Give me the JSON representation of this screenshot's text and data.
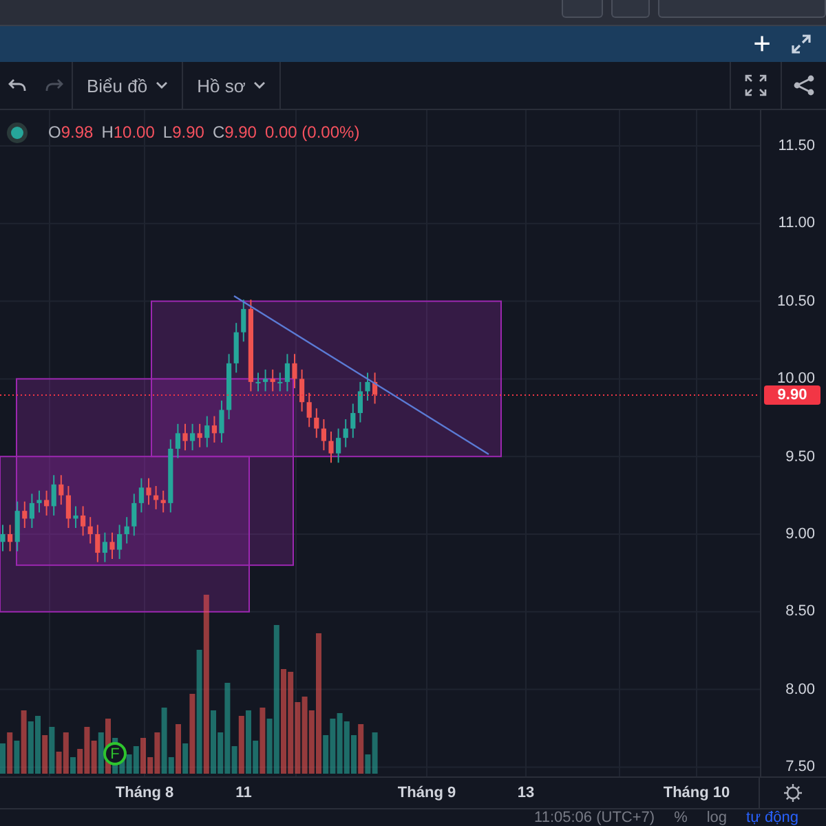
{
  "panel_bar": {
    "add": "+"
  },
  "toolbar": {
    "menus": [
      {
        "label": "Biểu đồ"
      },
      {
        "label": "Hồ sơ"
      }
    ]
  },
  "legend": {
    "fields": [
      {
        "key": "O",
        "value": "9.98"
      },
      {
        "key": "H",
        "value": "10.00"
      },
      {
        "key": "L",
        "value": "9.90"
      },
      {
        "key": "C",
        "value": "9.90"
      }
    ],
    "change": "0.00 (0.00%)"
  },
  "price_axis": {
    "labels": [
      "11.50",
      "11.00",
      "10.50",
      "10.00",
      "9.50",
      "9.00",
      "8.50",
      "8.00",
      "7.50"
    ],
    "last_price": "9.90"
  },
  "event_marker": {
    "label": "F"
  },
  "time_axis": {
    "labels": [
      "Tháng 8",
      "11",
      "Tháng 9",
      "13",
      "Tháng 10"
    ]
  },
  "status_bar": {
    "items": [
      "11:05:06 (UTC+7)",
      "%",
      "log",
      "tự động"
    ]
  }
}
